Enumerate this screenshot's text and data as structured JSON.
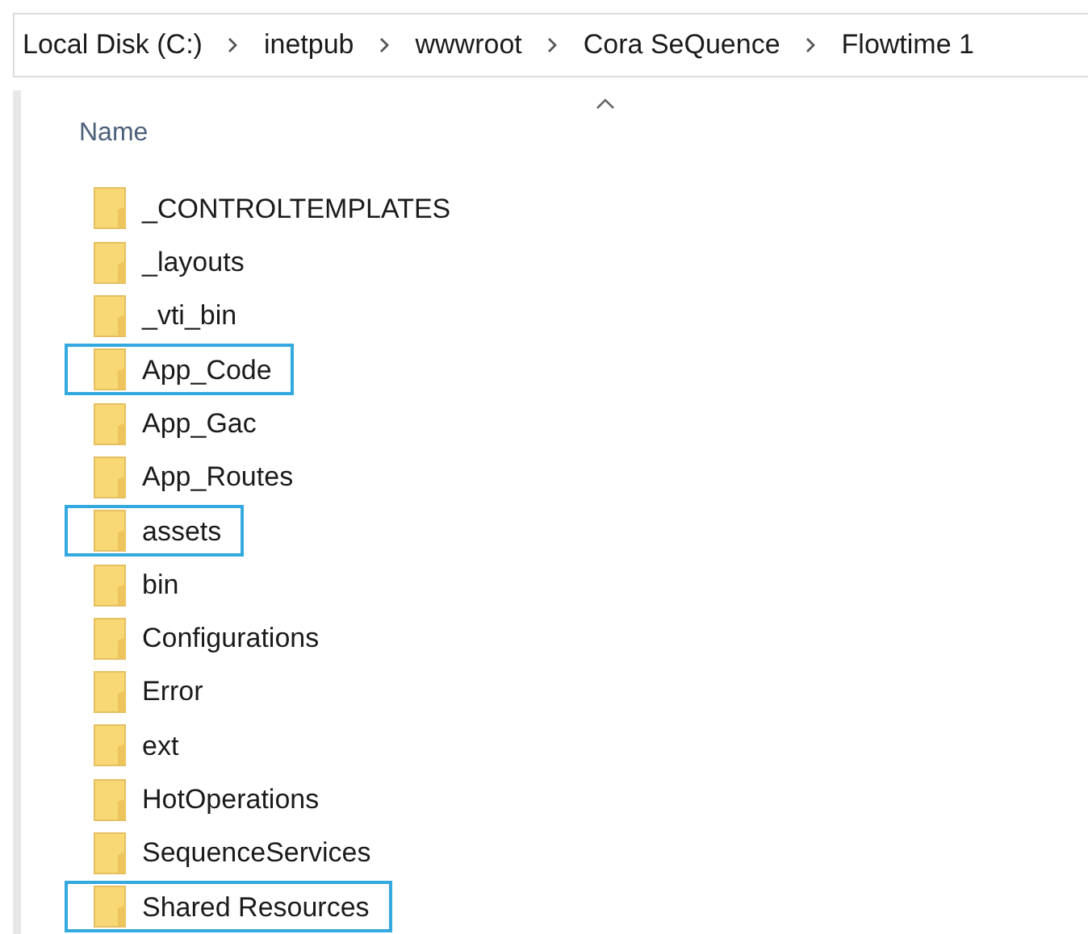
{
  "breadcrumb": [
    "Local Disk (C:)",
    "inetpub",
    "wwwroot",
    "Cora SeQuence",
    "Flowtime 1"
  ],
  "column_header": {
    "label": "Name"
  },
  "files": [
    {
      "name": "_CONTROLTEMPLATES",
      "highlighted": false
    },
    {
      "name": "_layouts",
      "highlighted": false
    },
    {
      "name": "_vti_bin",
      "highlighted": false
    },
    {
      "name": "App_Code",
      "highlighted": true
    },
    {
      "name": "App_Gac",
      "highlighted": false
    },
    {
      "name": "App_Routes",
      "highlighted": false
    },
    {
      "name": "assets",
      "highlighted": true
    },
    {
      "name": "bin",
      "highlighted": false
    },
    {
      "name": "Configurations",
      "highlighted": false
    },
    {
      "name": "Error",
      "highlighted": false
    },
    {
      "name": "ext",
      "highlighted": false
    },
    {
      "name": "HotOperations",
      "highlighted": false
    },
    {
      "name": "SequenceServices",
      "highlighted": false
    },
    {
      "name": "Shared Resources",
      "highlighted": true
    }
  ]
}
